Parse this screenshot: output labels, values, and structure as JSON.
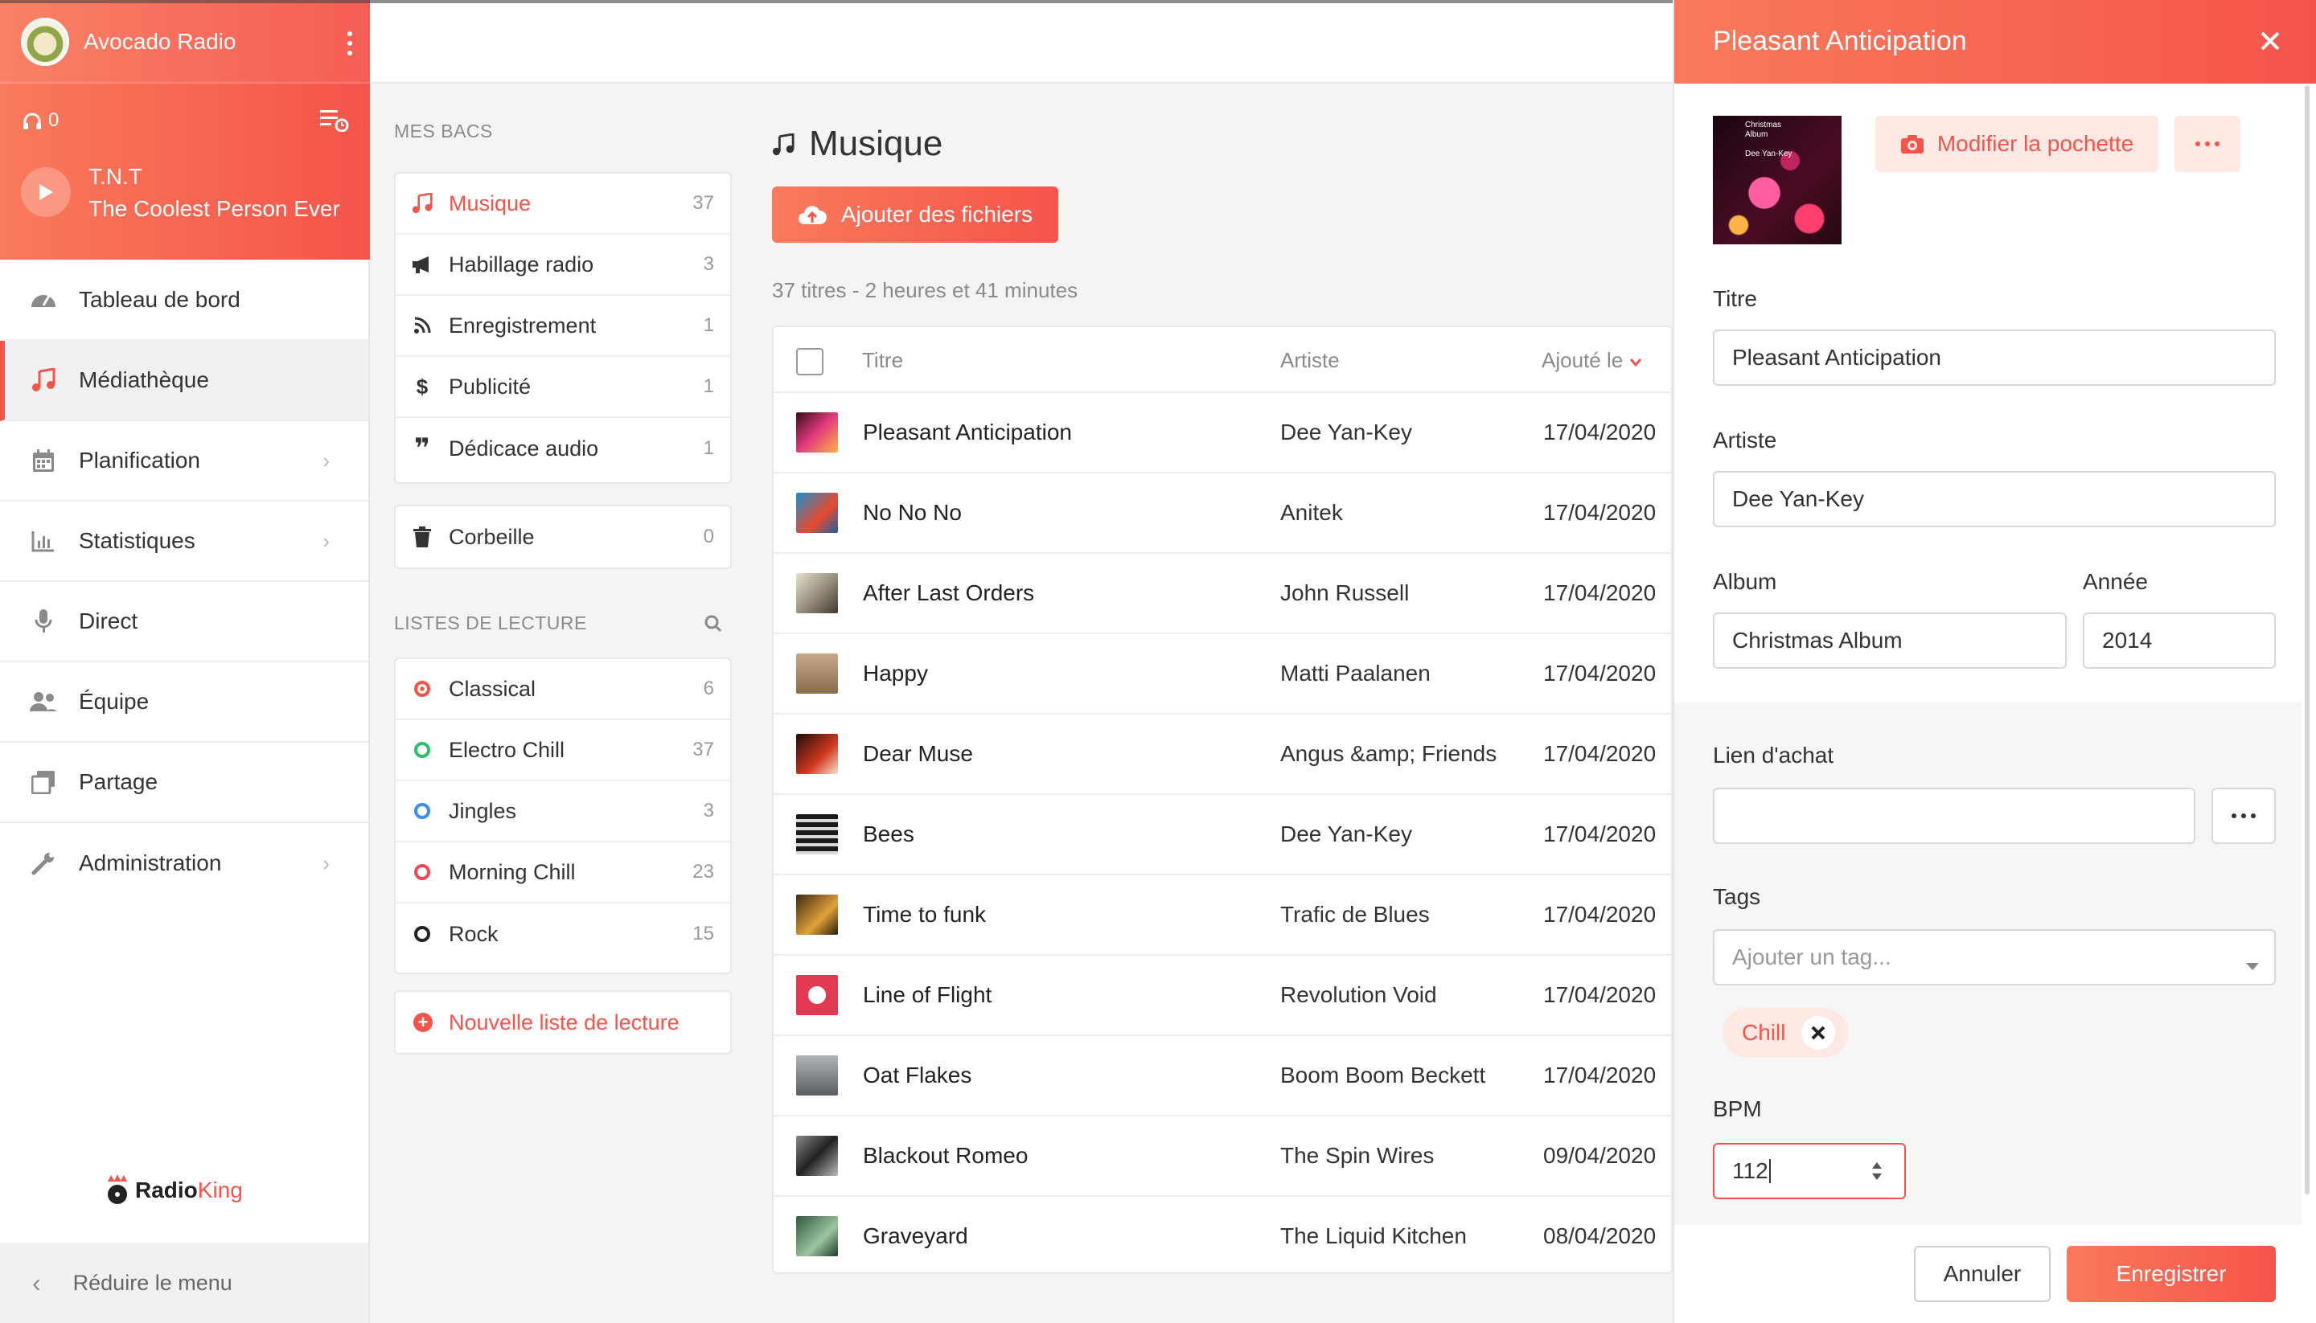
{
  "colors": {
    "accent": "#f5544a",
    "accent_light": "#f97a5c",
    "accent_bg": "#fde8e3"
  },
  "app": {
    "name": "Avocado Radio",
    "listeners": "0"
  },
  "now_playing": {
    "artist": "T.N.T",
    "title": "The Coolest Person Ever"
  },
  "nav": [
    {
      "label": "Tableau de bord",
      "icon": "dashboard-icon",
      "chevron": false
    },
    {
      "label": "Médiathèque",
      "icon": "music-note-icon",
      "chevron": false,
      "active": true
    },
    {
      "label": "Planification",
      "icon": "calendar-icon",
      "chevron": true
    },
    {
      "label": "Statistiques",
      "icon": "bar-chart-icon",
      "chevron": true
    },
    {
      "label": "Direct",
      "icon": "microphone-icon",
      "chevron": false
    },
    {
      "label": "Équipe",
      "icon": "users-icon",
      "chevron": false
    },
    {
      "label": "Partage",
      "icon": "share-icon",
      "chevron": false
    },
    {
      "label": "Administration",
      "icon": "wrench-icon",
      "chevron": true
    }
  ],
  "brand": {
    "part1": "Radio",
    "part2": "King"
  },
  "collapse_label": "Réduire le menu",
  "bins": {
    "heading": "MES BACS",
    "items": [
      {
        "label": "Musique",
        "count": "37",
        "icon": "music-note-icon",
        "active": true
      },
      {
        "label": "Habillage radio",
        "count": "3",
        "icon": "megaphone-icon"
      },
      {
        "label": "Enregistrement",
        "count": "1",
        "icon": "rss-icon"
      },
      {
        "label": "Publicité",
        "count": "1",
        "icon": "dollar-icon"
      },
      {
        "label": "Dédicace audio",
        "count": "1",
        "icon": "quote-icon"
      }
    ],
    "trash": {
      "label": "Corbeille",
      "count": "0"
    }
  },
  "playlists": {
    "heading": "LISTES DE LECTURE",
    "items": [
      {
        "label": "Classical",
        "count": "6",
        "color": "#f5544a"
      },
      {
        "label": "Electro Chill",
        "count": "37",
        "color": "#2dbf6e"
      },
      {
        "label": "Jingles",
        "count": "3",
        "color": "#3b8ef0"
      },
      {
        "label": "Morning Chill",
        "count": "23",
        "color": "#f04a5a"
      },
      {
        "label": "Rock",
        "count": "15",
        "color": "#222222"
      }
    ],
    "new_label": "Nouvelle liste de lecture"
  },
  "main": {
    "title": "Musique",
    "upload_label": "Ajouter des fichiers",
    "summary": "37 titres - 2 heures et 41 minutes",
    "columns": {
      "title": "Titre",
      "artist": "Artiste",
      "added": "Ajouté le"
    },
    "rows": [
      {
        "title": "Pleasant Anticipation",
        "artist": "Dee Yan-Key",
        "date": "17/04/2020",
        "thumb": "linear-gradient(135deg,#3a0c1c,#e23a7c 50%,#ffb347)"
      },
      {
        "title": "No No No",
        "artist": "Anitek",
        "date": "17/04/2020",
        "thumb": "linear-gradient(135deg,#1a8fd1,#e84a2e 60%,#1560a8)"
      },
      {
        "title": "After Last Orders",
        "artist": "John Russell",
        "date": "17/04/2020",
        "thumb": "linear-gradient(135deg,#e6e1d2,#8a8070 60%,#3d3a33)"
      },
      {
        "title": "Happy",
        "artist": "Matti Paalanen",
        "date": "17/04/2020",
        "thumb": "linear-gradient(180deg,#c9a98a,#8b6b4c)"
      },
      {
        "title": "Dear Muse",
        "artist": "Angus &amp; Friends",
        "date": "17/04/2020",
        "thumb": "linear-gradient(135deg,#200a08,#d23a20 60%,#f5e1d0)"
      },
      {
        "title": "Bees",
        "artist": "Dee Yan-Key",
        "date": "17/04/2020",
        "thumb": "repeating-linear-gradient(180deg,#1a1a1a 0 6px,#d9d9d9 6px 10px)"
      },
      {
        "title": "Time to funk",
        "artist": "Trafic de Blues",
        "date": "17/04/2020",
        "thumb": "linear-gradient(135deg,#3b2a10,#e0a13a 60%,#2a1c08)"
      },
      {
        "title": "Line of Flight",
        "artist": "Revolution Void",
        "date": "17/04/2020",
        "thumb": "radial-gradient(circle,#ffffff 0 30%,#e23a52 31%)"
      },
      {
        "title": "Oat Flakes",
        "artist": "Boom Boom Beckett",
        "date": "17/04/2020",
        "thumb": "linear-gradient(180deg,#b0b4b8,#5a5e63)"
      },
      {
        "title": "Blackout Romeo",
        "artist": "The Spin Wires",
        "date": "09/04/2020",
        "thumb": "linear-gradient(135deg,#888,#222 50%,#bbb)"
      },
      {
        "title": "Graveyard",
        "artist": "The Liquid Kitchen",
        "date": "08/04/2020",
        "thumb": "linear-gradient(135deg,#2e5a3c,#9bc4a0 60%,#1d3b27)"
      }
    ]
  },
  "panel": {
    "title": "Pleasant Anticipation",
    "cover_text": [
      "Christmas",
      "Album",
      "Dee Yan-Key"
    ],
    "change_cover_label": "Modifier la pochette",
    "fields": {
      "title_label": "Titre",
      "title_value": "Pleasant Anticipation",
      "artist_label": "Artiste",
      "artist_value": "Dee Yan-Key",
      "album_label": "Album",
      "album_value": "Christmas Album",
      "year_label": "Année",
      "year_value": "2014",
      "buy_label": "Lien d'achat",
      "buy_value": "",
      "tags_label": "Tags",
      "tags_placeholder": "Ajouter un tag...",
      "tag": "Chill",
      "bpm_label": "BPM",
      "bpm_value": "112"
    },
    "cancel_label": "Annuler",
    "save_label": "Enregistrer"
  }
}
